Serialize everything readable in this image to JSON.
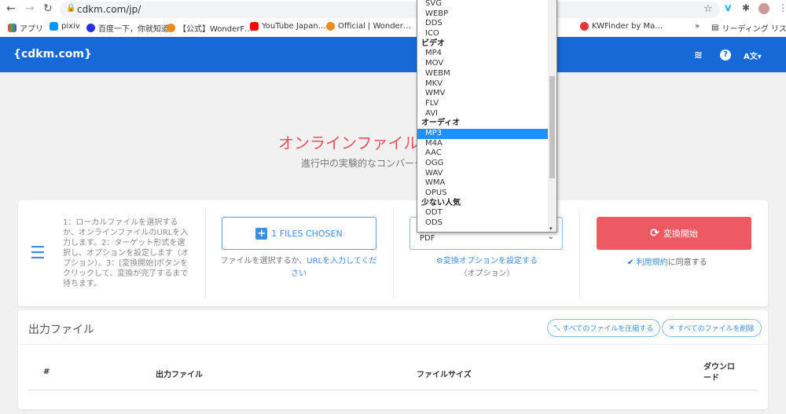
{
  "browser": {
    "url": "cdkm.com/jp/",
    "bookmarks": [
      "アプリ",
      "pixiv",
      "百度一下，你就知道",
      "【公式】WonderF…",
      "YouTube Japan…",
      "Official | Wonder…",
      "KWFinder by Ma…",
      "»",
      "リーディング リスト"
    ]
  },
  "header": {
    "logo": "{cdkm.com}",
    "icons": [
      "layers-icon",
      "help-icon",
      "language-icon"
    ]
  },
  "hero": {
    "title": "オンラインファイル",
    "subtitle": "進行中の実験的なコンバータ"
  },
  "steps_text": "1：ローカルファイルを選択するか、オンラインファイルのURLを入力します。2：ターゲット形式を選択し、オプションを設定します（オプション）。3：[変換開始]ボタンをクリックして、変換が完了するまで待ちます。",
  "upload": {
    "button": "1 FILES CHOSEN",
    "hint_prefix": "ファイルを選択するか、",
    "hint_link": "URLを入力してください"
  },
  "format": {
    "selected": "PDF",
    "options_link": "変換オプションを設定する",
    "options_suffix": "（オプション）"
  },
  "convert": {
    "button": "変換開始",
    "terms_link": "利用規約",
    "terms_suffix": "に同意する",
    "agreed": true
  },
  "output": {
    "title": "出力ファイル",
    "compress_all": "すべてのファイルを圧縮する",
    "delete_all": "すべてのファイルを削除",
    "columns": [
      "#",
      "出力ファイル",
      "ファイルサイズ",
      "ダウンロード"
    ]
  },
  "dropdown": {
    "items": [
      {
        "label": "SVG"
      },
      {
        "label": "WEBP"
      },
      {
        "label": "DDS"
      },
      {
        "label": "ICO"
      },
      {
        "label": "ビデオ",
        "group": true
      },
      {
        "label": "MP4"
      },
      {
        "label": "MOV"
      },
      {
        "label": "WEBM"
      },
      {
        "label": "MKV"
      },
      {
        "label": "WMV"
      },
      {
        "label": "FLV"
      },
      {
        "label": "AVI"
      },
      {
        "label": "オーディオ",
        "group": true
      },
      {
        "label": "MP3",
        "selected": true
      },
      {
        "label": "M4A"
      },
      {
        "label": "AAC"
      },
      {
        "label": "OGG"
      },
      {
        "label": "WAV"
      },
      {
        "label": "WMA"
      },
      {
        "label": "OPUS"
      },
      {
        "label": "少ない人気",
        "group": true
      },
      {
        "label": "ODT"
      },
      {
        "label": "ODS"
      }
    ]
  },
  "colors": {
    "header": "#1769d8",
    "accent": "#3f8de0",
    "convert": "#ee5a64",
    "title": "#e8505b"
  }
}
